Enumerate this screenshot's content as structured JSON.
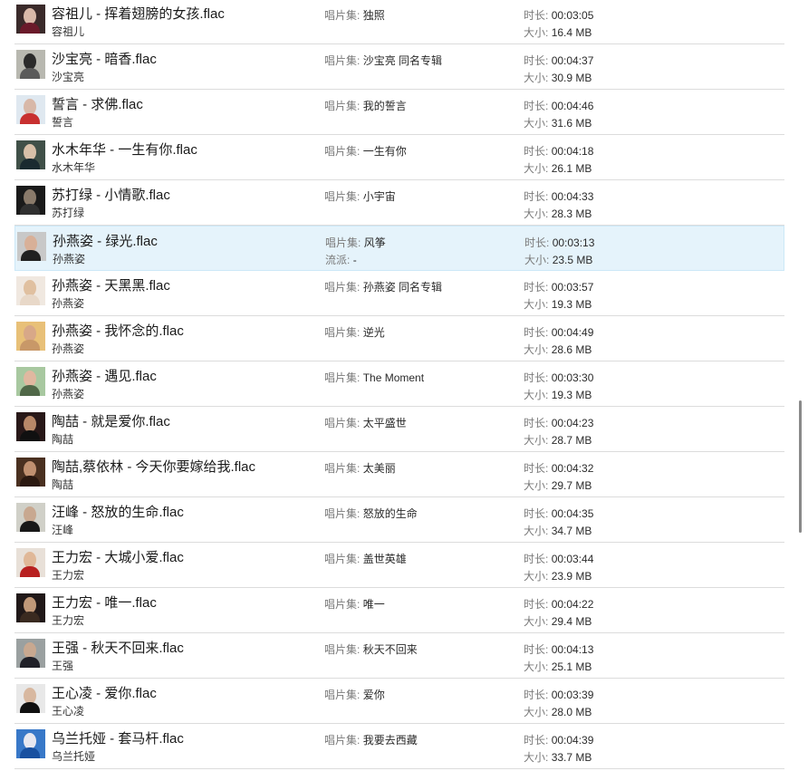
{
  "labels": {
    "album": "唱片集:",
    "duration": "时长:",
    "size": "大小:",
    "genre": "流派:"
  },
  "tracks": [
    {
      "title": "容祖儿 - 挥着翅膀的女孩.flac",
      "artist": "容祖儿",
      "album": "独照",
      "duration": "00:03:05",
      "size": "16.4 MB",
      "thumb_colors": [
        "#3a2a2a",
        "#d9b9a9",
        "#6a1a2a"
      ]
    },
    {
      "title": "沙宝亮 - 暗香.flac",
      "artist": "沙宝亮",
      "album": "沙宝亮 同名专辑",
      "duration": "00:04:37",
      "size": "30.9 MB",
      "thumb_colors": [
        "#b8b8b0",
        "#2a2a2a",
        "#5a5a5a"
      ]
    },
    {
      "title": "誓言 - 求佛.flac",
      "artist": "誓言",
      "album": "我的誓言",
      "duration": "00:04:46",
      "size": "31.6 MB",
      "thumb_colors": [
        "#dfe8f0",
        "#d8b8a8",
        "#c83030"
      ]
    },
    {
      "title": "水木年华 - 一生有你.flac",
      "artist": "水木年华",
      "album": "一生有你",
      "duration": "00:04:18",
      "size": "26.1 MB",
      "thumb_colors": [
        "#405048",
        "#d8c0a8",
        "#1a2a30"
      ]
    },
    {
      "title": "苏打绿 - 小情歌.flac",
      "artist": "苏打绿",
      "album": "小宇宙",
      "duration": "00:04:33",
      "size": "28.3 MB",
      "thumb_colors": [
        "#1a1a1a",
        "#8a7a6a",
        "#303030"
      ]
    },
    {
      "title": "孙燕姿 - 绿光.flac",
      "artist": "孙燕姿",
      "album": "风筝",
      "genre": "-",
      "duration": "00:03:13",
      "size": "23.5 MB",
      "selected": true,
      "thumb_colors": [
        "#c8c8c8",
        "#d8b098",
        "#202020"
      ]
    },
    {
      "title": "孙燕姿 - 天黑黑.flac",
      "artist": "孙燕姿",
      "album": "孙燕姿 同名专辑",
      "duration": "00:03:57",
      "size": "19.3 MB",
      "thumb_colors": [
        "#f0e8e0",
        "#e0c0a0",
        "#e8d8c8"
      ]
    },
    {
      "title": "孙燕姿 - 我怀念的.flac",
      "artist": "孙燕姿",
      "album": "逆光",
      "duration": "00:04:49",
      "size": "28.6 MB",
      "thumb_colors": [
        "#e8c078",
        "#d8a888",
        "#c89868"
      ]
    },
    {
      "title": "孙燕姿 - 遇见.flac",
      "artist": "孙燕姿",
      "album": "The Moment",
      "duration": "00:03:30",
      "size": "19.3 MB",
      "thumb_colors": [
        "#a8c8a0",
        "#e0b8a0",
        "#506848"
      ]
    },
    {
      "title": "陶喆 - 就是爱你.flac",
      "artist": "陶喆",
      "album": "太平盛世",
      "duration": "00:04:23",
      "size": "28.7 MB",
      "thumb_colors": [
        "#281818",
        "#b88868",
        "#101010"
      ]
    },
    {
      "title": "陶喆,蔡依林 - 今天你要嫁给我.flac",
      "artist": "陶喆",
      "album": "太美丽",
      "duration": "00:04:32",
      "size": "29.7 MB",
      "thumb_colors": [
        "#4a3020",
        "#c09070",
        "#2a1810"
      ]
    },
    {
      "title": "汪峰 - 怒放的生命.flac",
      "artist": "汪峰",
      "album": "怒放的生命",
      "duration": "00:04:35",
      "size": "34.7 MB",
      "thumb_colors": [
        "#d0d0c8",
        "#c8a890",
        "#181818"
      ]
    },
    {
      "title": "王力宏 - 大城小爱.flac",
      "artist": "王力宏",
      "album": "盖世英雄",
      "duration": "00:03:44",
      "size": "23.9 MB",
      "thumb_colors": [
        "#e8e0d8",
        "#e0b898",
        "#b82020"
      ]
    },
    {
      "title": "王力宏 - 唯一.flac",
      "artist": "王力宏",
      "album": "唯一",
      "duration": "00:04:22",
      "size": "29.4 MB",
      "thumb_colors": [
        "#201818",
        "#c09878",
        "#3a2a20"
      ]
    },
    {
      "title": "王强 - 秋天不回来.flac",
      "artist": "王强",
      "album": "秋天不回来",
      "duration": "00:04:13",
      "size": "25.1 MB",
      "thumb_colors": [
        "#9aa0a0",
        "#c8a890",
        "#202028"
      ]
    },
    {
      "title": "王心凌 - 爱你.flac",
      "artist": "王心凌",
      "album": "爱你",
      "duration": "00:03:39",
      "size": "28.0 MB",
      "thumb_colors": [
        "#e8e8e8",
        "#d8b8a0",
        "#101010"
      ]
    },
    {
      "title": "乌兰托娅 - 套马杆.flac",
      "artist": "乌兰托娅",
      "album": "我要去西藏",
      "duration": "00:04:39",
      "size": "33.7 MB",
      "thumb_colors": [
        "#3878c8",
        "#e8e8f0",
        "#1850a0"
      ]
    }
  ]
}
